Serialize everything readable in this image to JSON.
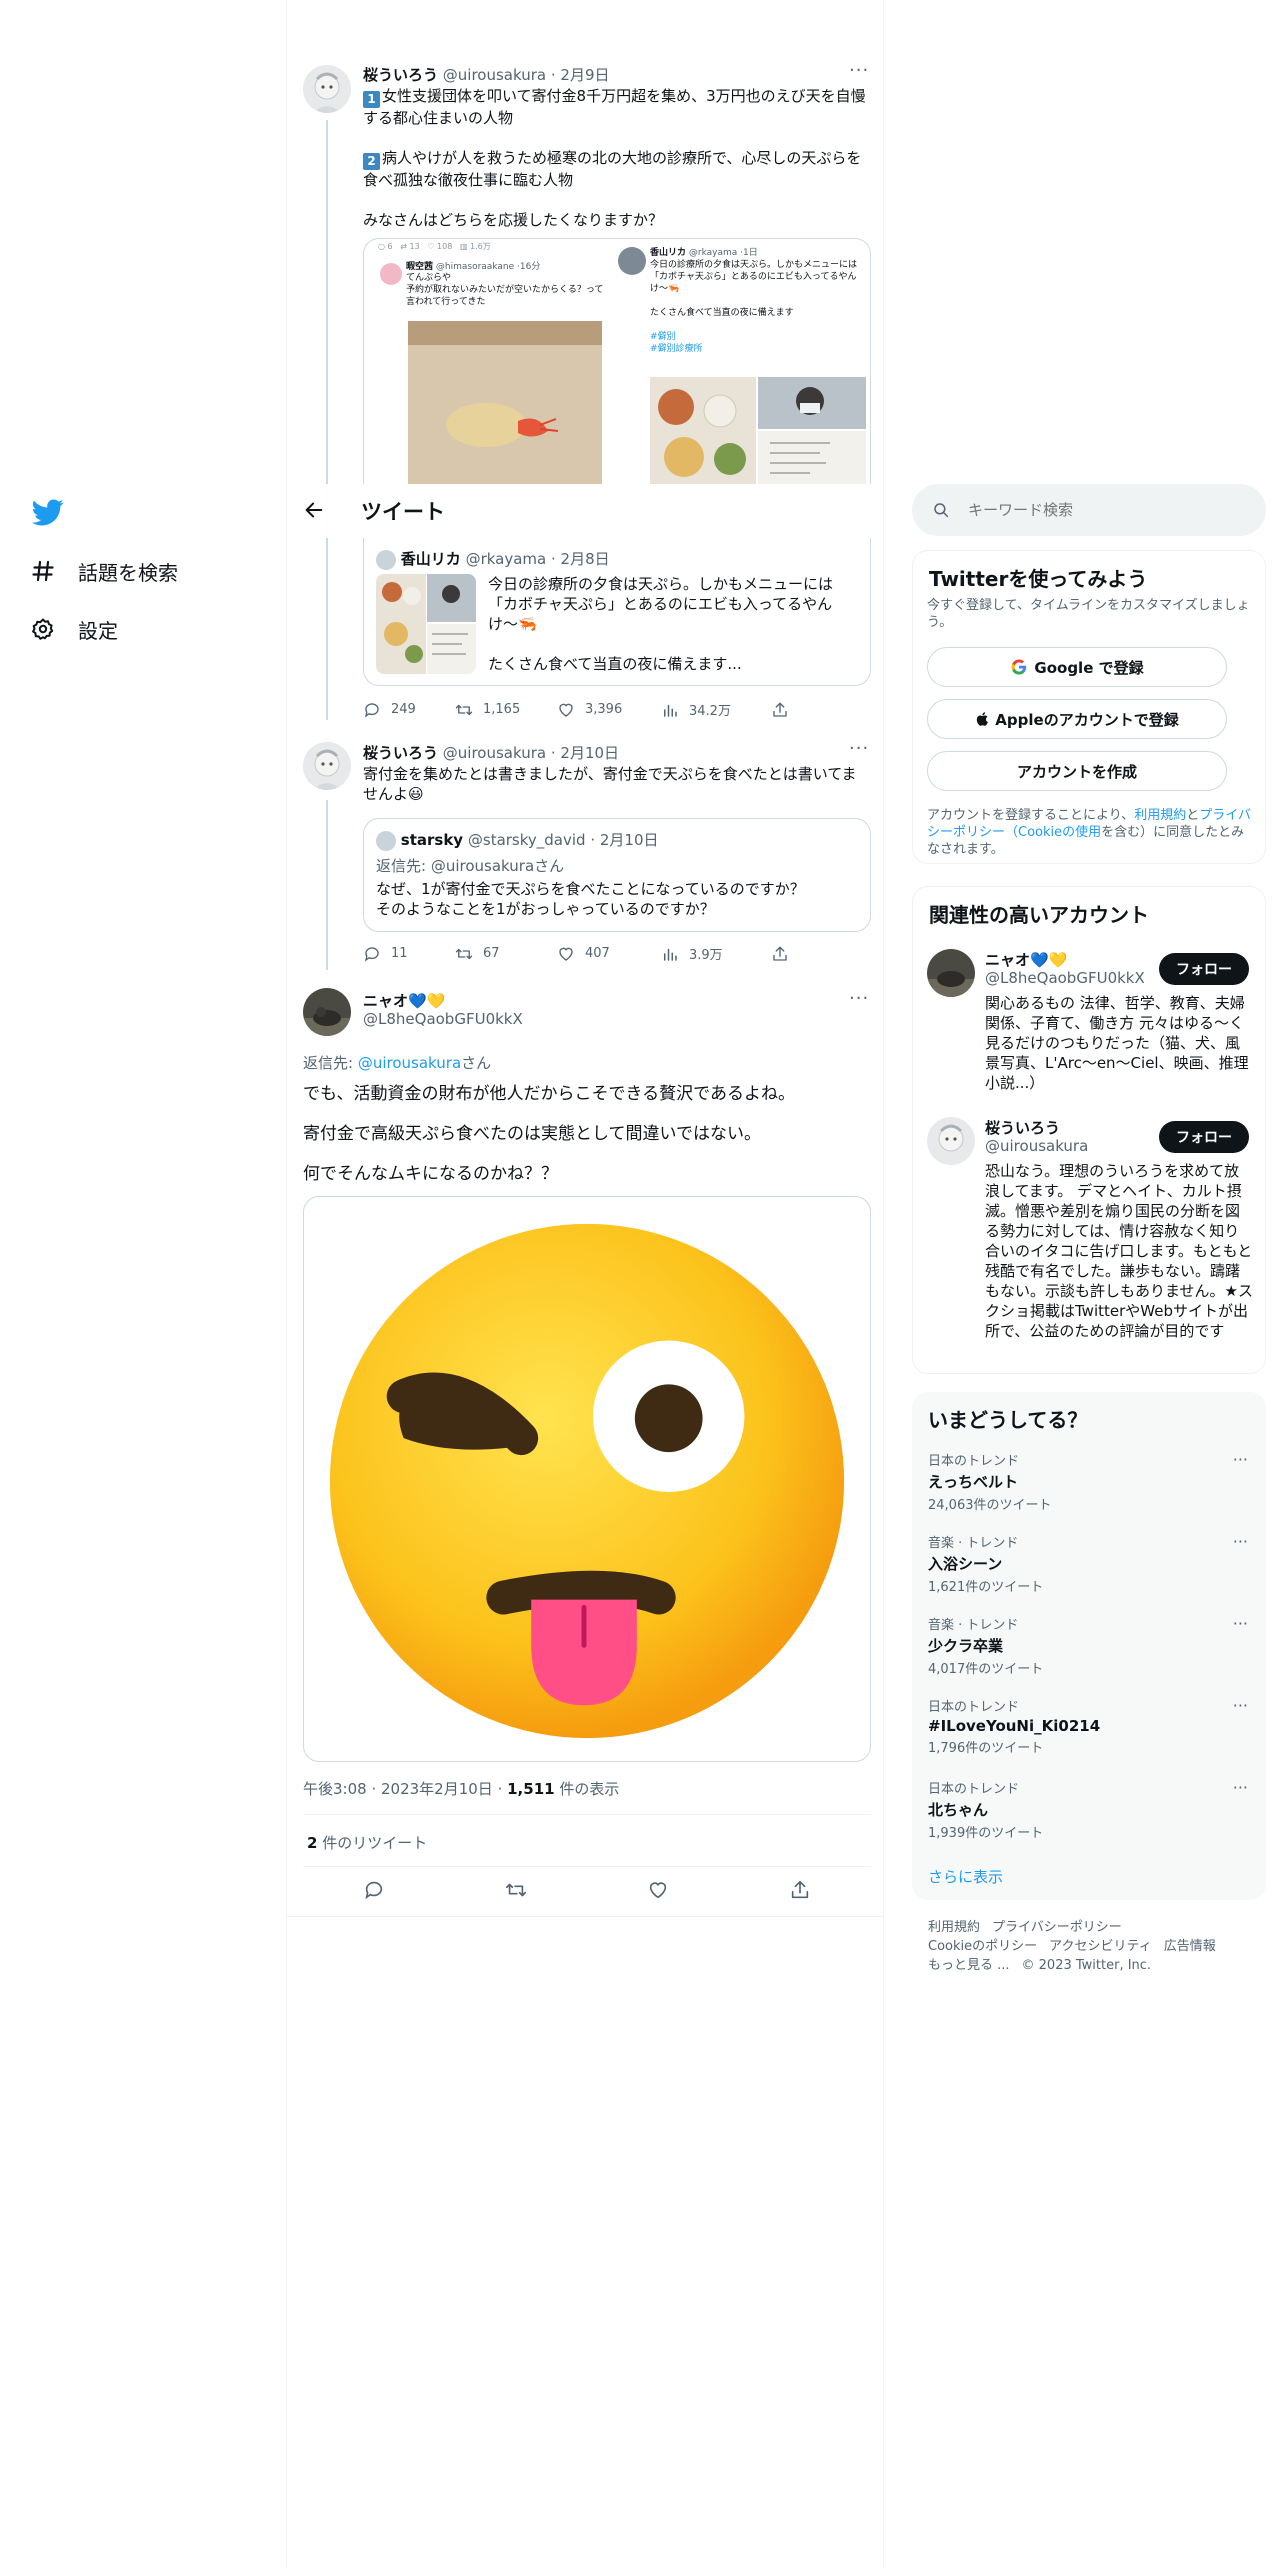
{
  "nav": {
    "logo_icon": "twitter-bird-icon",
    "items": [
      {
        "label": "話題を検索",
        "icon": "hashtag-icon"
      },
      {
        "label": "設定",
        "icon": "gear-icon"
      }
    ]
  },
  "header": {
    "title": "ツイート",
    "back_icon": "arrow-left-icon"
  },
  "tweet1": {
    "name": "桜ういろう",
    "handle": "@uirousakura",
    "date": "2月9日",
    "p1_num": "1",
    "p1": "女性支援団体を叩いて寄付金8千万円超を集め、3万円也のえび天を自慢する都心住まいの人物",
    "p2_num": "2",
    "p2": "病人やけが人を救うため極寒の北の大地の診療所で、心尽しの天ぷらを食べ孤独な徹夜仕事に臨む人物",
    "p3": "みなさんはどちらを応援したくなりますか？",
    "image": {
      "left_name": "暇空茜",
      "left_handle": "@himasoraakane",
      "left_time": "16分",
      "left_line1": "てんぷらや",
      "left_line2": "予約が取れないみたいだが空いたからくる？って言われて行ってきた",
      "left_stats": [
        "6",
        "13",
        "108",
        "1.6万"
      ],
      "right_name": "香山リカ",
      "right_handle": "@rkayama",
      "right_time": "1日",
      "right_line1": "今日の診療所の夕食は天ぷら。しかもメニューには「カボチャ天ぷら」とあるのにエビも入ってるやんけ〜🦐",
      "right_line2": "たくさん食べて当直の夜に備えます",
      "right_tag1": "#僻別",
      "right_tag2": "#僻別診療所"
    },
    "quote": {
      "name": "香山リカ",
      "handle": "@rkayama",
      "date": "2月8日",
      "text1": "今日の診療所の夕食は天ぷら。しかもメニューには「カボチャ天ぷら」とあるのにエビも入ってるやんけ〜🦐",
      "text2": "たくさん食べて当直の夜に備えます..."
    },
    "stats": {
      "replies": "249",
      "retweets": "1,165",
      "likes": "3,396",
      "views": "34.2万"
    }
  },
  "tweet2": {
    "name": "桜ういろう",
    "handle": "@uirousakura",
    "date": "2月10日",
    "text": "寄付金を集めたとは書きましたが、寄付金で天ぷらを食べたとは書いてませんよ😃",
    "quote": {
      "name": "starsky",
      "handle": "@starsky_david",
      "date": "2月10日",
      "reply_to_label": "返信先:",
      "reply_to_handle": "@uirousakuraさん",
      "text": "なぜ、1が寄付金で天ぷらを食べたことになっているのですか？そのようなことを1がおっしゃっているのですか？"
    },
    "stats": {
      "replies": "11",
      "retweets": "67",
      "likes": "407",
      "views": "3.9万"
    }
  },
  "main_tweet": {
    "name": "ニャオ💙💛",
    "handle": "@L8heQaobGFU0kkX",
    "reply_label": "返信先:",
    "reply_handle": "@uirousakura",
    "reply_suffix": "さん",
    "line1": "でも、活動資金の財布が他人だからこそできる贅沢であるよね。",
    "line2": "寄付金で高級天ぷら食べたのは実態として間違いではない。",
    "line3": "何でそんなムキになるのかね？？",
    "media_icon": "winking-face-with-tongue-emoji",
    "time": "午後3:08",
    "date": "2023年2月10日",
    "views_count": "1,511",
    "views_label": "件の表示",
    "retweets_count": "2",
    "retweets_label": "件のリツイート"
  },
  "search": {
    "placeholder": "キーワード検索"
  },
  "signup": {
    "title": "Twitterを使ってみよう",
    "subtitle": "今すぐ登録して、タイムラインをカスタマイズしましょう。",
    "google_label": "Google で登録",
    "apple_label": "Appleのアカウントで登録",
    "create_label": "アカウントを作成",
    "terms_prefix": "アカウントを登録することにより、",
    "terms_link": "利用規約",
    "terms_and": "と",
    "privacy_link": "プライバシーポリシー",
    "cookie_link": "（Cookieの使用",
    "terms_suffix": "を含む）に同意したとみなされます。"
  },
  "related": {
    "title": "関連性の高いアカウント",
    "accounts": [
      {
        "name": "ニャオ💙💛",
        "handle": "@L8heQaobGFU0kkX",
        "follow": "フォロー",
        "bio": "関心あるもの 法律、哲学、教育、夫婦関係、子育て、働き方 元々はゆる〜く見るだけのつもりだった（猫、犬、風景写真、L'Arc～en～Ciel、映画、推理小説...）"
      },
      {
        "name": "桜ういろう",
        "handle": "@uirousakura",
        "follow": "フォロー",
        "bio": "恐山なう。理想のういろうを求めて放浪してます。 デマとヘイト、カルト摂滅。憎悪や差別を煽り国民の分断を図る勢力に対しては、情け容赦なく知り合いのイタコに告げ口します。もともと残酷で有名でした。謙歩もない。躊躇もない。示談も許しもありません。★スクショ掲載はTwitterやWebサイトが出所で、公益のための評論が目的です"
      }
    ]
  },
  "trends": {
    "title": "いまどうしてる？",
    "items": [
      {
        "context": "日本のトレンド",
        "name": "えっちベルト",
        "count": "24,063件のツイート"
      },
      {
        "context": "音楽 · トレンド",
        "name": "入浴シーン",
        "count": "1,621件のツイート"
      },
      {
        "context": "音楽 · トレンド",
        "name": "少クラ卒業",
        "count": "4,017件のツイート"
      },
      {
        "context": "日本のトレンド",
        "name": "#ILoveYouNi_Ki0214",
        "count": "1,796件のツイート"
      },
      {
        "context": "日本のトレンド",
        "name": "北ちゃん",
        "count": "1,939件のツイート"
      }
    ],
    "show_more": "さらに表示"
  },
  "footer": {
    "links": [
      "利用規約",
      "プライバシーポリシー",
      "Cookieのポリシー",
      "アクセシビリティ",
      "広告情報",
      "もっと見る ..."
    ],
    "copyright": "© 2023 Twitter, Inc."
  },
  "colors": {
    "accent": "#1d9bf0",
    "text": "#0f1419",
    "muted": "#536471",
    "border": "#cfd9de"
  }
}
